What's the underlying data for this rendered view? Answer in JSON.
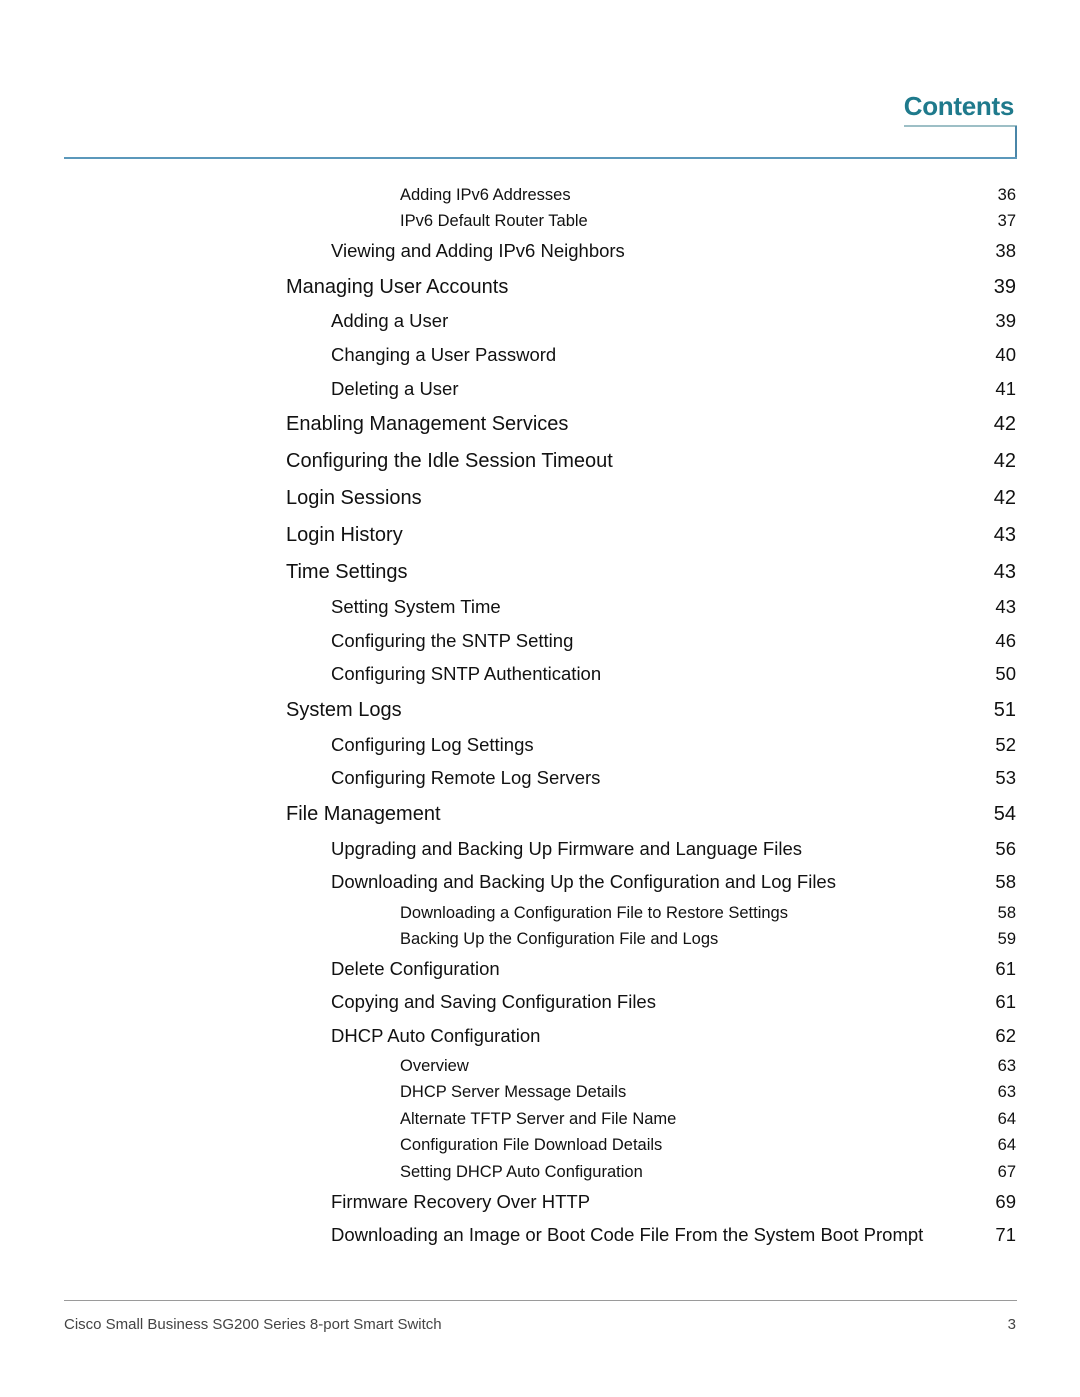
{
  "header": {
    "title": "Contents"
  },
  "toc": [
    {
      "level": 3,
      "label": "Adding IPv6 Addresses",
      "page": "36"
    },
    {
      "level": 3,
      "label": "IPv6 Default Router Table",
      "page": "37"
    },
    {
      "level": 2,
      "label": "Viewing and Adding IPv6 Neighbors",
      "page": "38"
    },
    {
      "level": 1,
      "label": "Managing User Accounts",
      "page": "39"
    },
    {
      "level": 2,
      "label": "Adding a User",
      "page": "39"
    },
    {
      "level": 2,
      "label": "Changing a User Password",
      "page": "40"
    },
    {
      "level": 2,
      "label": "Deleting a User",
      "page": "41"
    },
    {
      "level": 1,
      "label": "Enabling Management Services",
      "page": "42"
    },
    {
      "level": 1,
      "label": "Configuring the Idle Session Timeout",
      "page": "42"
    },
    {
      "level": 1,
      "label": "Login Sessions",
      "page": "42"
    },
    {
      "level": 1,
      "label": "Login History",
      "page": "43"
    },
    {
      "level": 1,
      "label": "Time Settings",
      "page": "43"
    },
    {
      "level": 2,
      "label": "Setting System Time",
      "page": "43"
    },
    {
      "level": 2,
      "label": "Configuring the SNTP Setting",
      "page": "46"
    },
    {
      "level": 2,
      "label": "Configuring SNTP Authentication",
      "page": "50"
    },
    {
      "level": 1,
      "label": "System Logs",
      "page": "51"
    },
    {
      "level": 2,
      "label": "Configuring Log Settings",
      "page": "52"
    },
    {
      "level": 2,
      "label": "Configuring Remote Log Servers",
      "page": "53"
    },
    {
      "level": 1,
      "label": "File Management",
      "page": "54"
    },
    {
      "level": 2,
      "label": "Upgrading and Backing Up Firmware and Language Files",
      "page": "56"
    },
    {
      "level": 2,
      "label": "Downloading and Backing Up the Configuration and Log Files",
      "page": "58"
    },
    {
      "level": 3,
      "label": "Downloading a Configuration File to Restore Settings",
      "page": "58"
    },
    {
      "level": 3,
      "label": "Backing Up the Configuration File and Logs",
      "page": "59"
    },
    {
      "level": 2,
      "label": "Delete Configuration",
      "page": "61"
    },
    {
      "level": 2,
      "label": "Copying and Saving Configuration Files",
      "page": "61"
    },
    {
      "level": 2,
      "label": "DHCP Auto Configuration",
      "page": "62"
    },
    {
      "level": 3,
      "label": "Overview",
      "page": "63"
    },
    {
      "level": 3,
      "label": "DHCP Server Message Details",
      "page": "63"
    },
    {
      "level": 3,
      "label": "Alternate TFTP Server and File Name",
      "page": "64"
    },
    {
      "level": 3,
      "label": "Configuration File Download Details",
      "page": "64"
    },
    {
      "level": 3,
      "label": "Setting DHCP Auto Configuration",
      "page": "67"
    },
    {
      "level": 2,
      "label": "Firmware Recovery Over HTTP",
      "page": "69"
    },
    {
      "level": 2,
      "label": "Downloading an Image or Boot Code File From the System Boot Prompt",
      "page": "71"
    }
  ],
  "footer": {
    "text": "Cisco Small Business SG200 Series 8-port Smart Switch",
    "page": "3"
  }
}
